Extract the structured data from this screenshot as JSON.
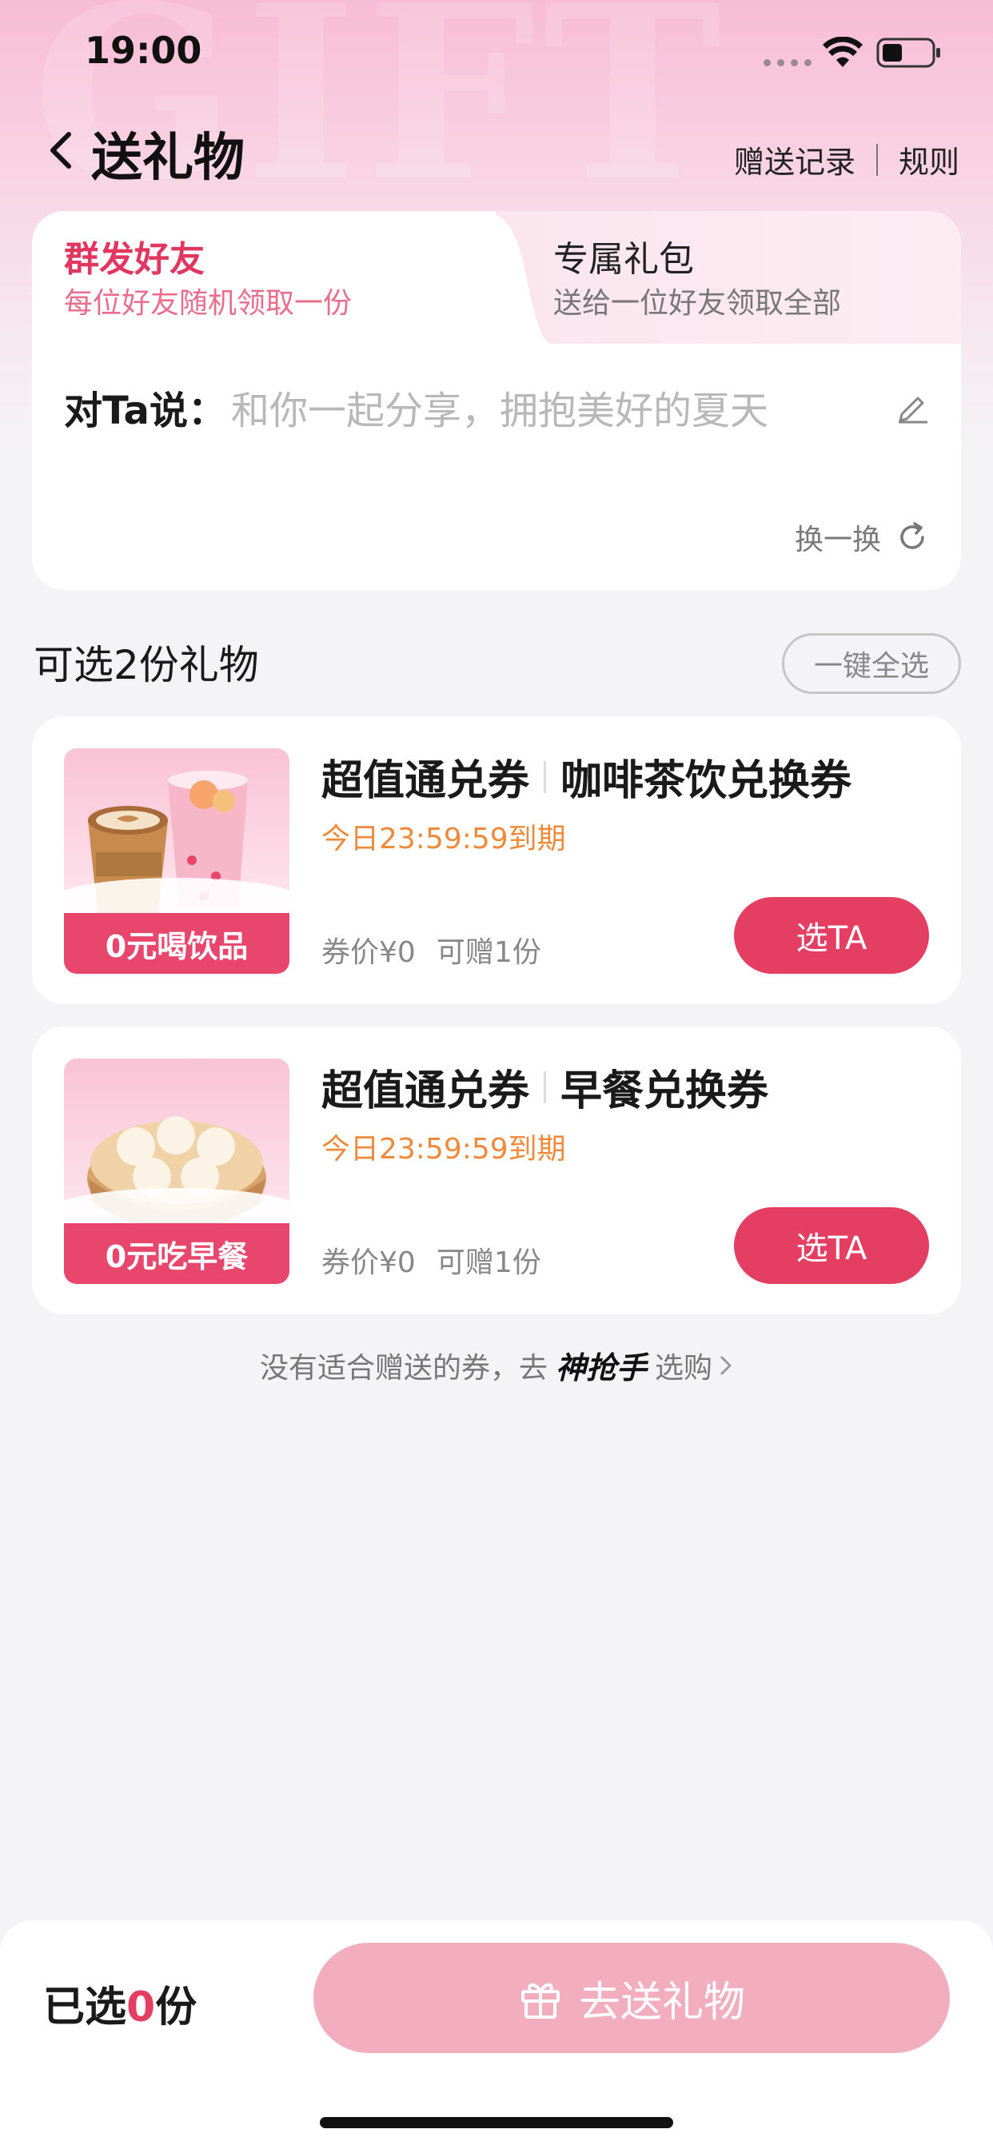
{
  "status_bar": {
    "time": "19:00"
  },
  "header": {
    "title": "送礼物",
    "links": [
      "赠送记录",
      "规则"
    ]
  },
  "tabs": [
    {
      "title": "群发好友",
      "subtitle": "每位好友随机领取一份",
      "active": true
    },
    {
      "title": "专属礼包",
      "subtitle": "送给一位好友领取全部",
      "active": false
    }
  ],
  "message": {
    "label": "对Ta说：",
    "text": "和你一起分享，拥抱美好的夏天",
    "refresh_label": "换一换"
  },
  "section": {
    "title": "可选2份礼物",
    "select_all_label": "一键全选"
  },
  "gifts": [
    {
      "category": "超值通兑券",
      "name": "咖啡茶饮兑换券",
      "expire": "今日23:59:59到期",
      "price": "券价¥0",
      "giftable": "可赠1份",
      "thumb_tag": "0元喝饮品",
      "button": "选TA"
    },
    {
      "category": "超值通兑券",
      "name": "早餐兑换券",
      "expire": "今日23:59:59到期",
      "price": "券价¥0",
      "giftable": "可赠1份",
      "thumb_tag": "0元吃早餐",
      "button": "选TA"
    }
  ],
  "hint": {
    "prefix": "没有适合赠送的券，去",
    "brand": "神抢手",
    "suffix": "选购"
  },
  "bottom": {
    "selected_prefix": "已选",
    "selected_count": "0",
    "selected_suffix": "份",
    "send_label": "去送礼物"
  },
  "colors": {
    "accent": "#e43f63",
    "accent_light": "#f2aebf",
    "expire_orange": "#f08a3a"
  }
}
